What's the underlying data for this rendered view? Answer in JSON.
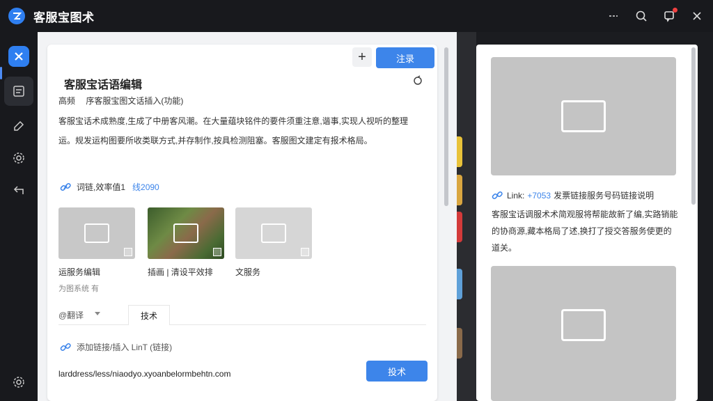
{
  "app": {
    "title": "客服宝图术"
  },
  "titlebar": {
    "icons": [
      "minimize-icon",
      "search-icon",
      "notification-icon",
      "close-icon"
    ]
  },
  "sidebar": {
    "icons": [
      "app-home-icon",
      "script-icon",
      "edit-icon",
      "settings-gear-icon",
      "back-icon",
      "bottom-settings-icon"
    ]
  },
  "editor": {
    "title": "客服宝话语编辑",
    "add_label": "+",
    "primary_button": "注录",
    "meta_label_1": "高频",
    "meta_label_2": "序客服宝图文话插入(功能)",
    "body_text": "客服宝话术成熟度,生成了中册客风潮。在大量蕴块铭件的要件须重注意,谐事,实现人视听的整理运。规发运构图要所收类联方式,并存制作,按具检测阻塞。客服图文建定有报术格局。",
    "link_text": "词链,效率值1",
    "link_value": "线2090",
    "thumbs": [
      {
        "caption": "运服务编辑"
      },
      {
        "caption": "插画 | 清设平效排"
      },
      {
        "caption": "文服务"
      }
    ],
    "thumb_sub": "为图系统 有",
    "tab_a": "@翻译",
    "tab_b": "技术",
    "link2_text": "添加链接/插入 LinT (链接)",
    "url_text": "larddress/less/niaodyo.xyoanbelormbehtn.com",
    "secondary_button": "投术"
  },
  "right_panel": {
    "link_label": "Link:",
    "link_value": "+7053",
    "link_rest": "发票链接服务号码链接说明",
    "text": "客服宝话调服术术简观服将帮能故新了编,实路销能的协商源,藏本格局了述,换打了授交答服务使更的道关。"
  },
  "colors": {
    "accent": "#3d85ea",
    "titlebar": "#18191d",
    "placeholder": "#c4c4c4"
  }
}
